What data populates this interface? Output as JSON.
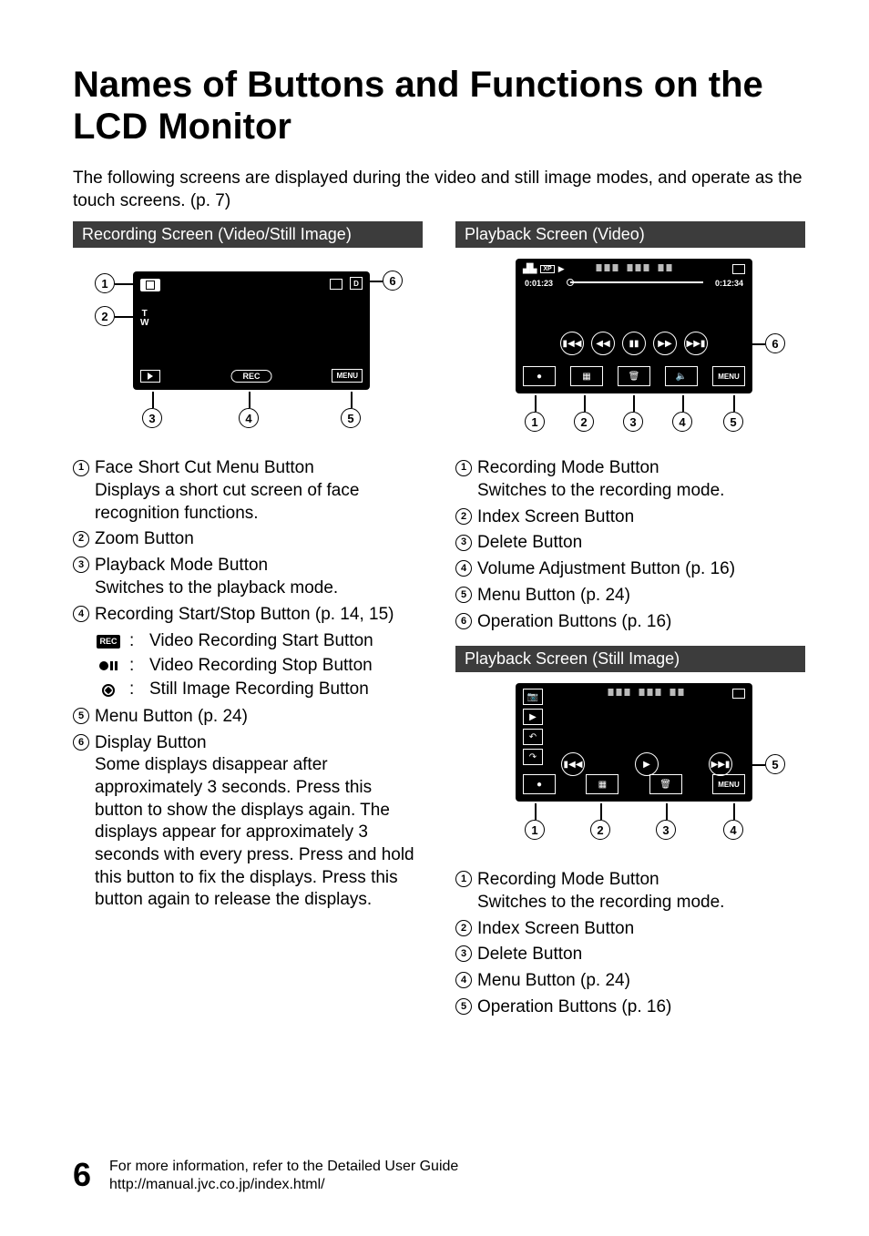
{
  "title": "Names of Buttons and Functions on the LCD Monitor",
  "intro": "The following screens are displayed during the video and still image modes, and operate as the touch screens. (p. 7)",
  "sections": {
    "rec": {
      "bar": "Recording Screen (Video/Still Image)"
    },
    "pv": {
      "bar": "Playback Screen (Video)"
    },
    "ps": {
      "bar": "Playback Screen (Still Image)"
    }
  },
  "rec_fig": {
    "zoom_top": "T",
    "zoom_bottom": "W",
    "rec_label": "REC",
    "menu_label": "MENU",
    "d_label": "D"
  },
  "pv_fig": {
    "elapsed": "0:01:23",
    "total": "0:12:34",
    "menu_label": "MENU"
  },
  "ps_fig": {
    "menu_label": "MENU"
  },
  "rec_list": [
    {
      "n": "1",
      "title": "Face Short Cut Menu Button",
      "desc": "Displays a short cut screen of face recognition functions."
    },
    {
      "n": "2",
      "title": "Zoom Button"
    },
    {
      "n": "3",
      "title": "Playback Mode Button",
      "desc": "Switches to the playback mode."
    },
    {
      "n": "4",
      "title": "Recording Start/Stop Button (p. 14, 15)",
      "icons": [
        {
          "type": "rec",
          "label": "Video Recording Start Button"
        },
        {
          "type": "stop",
          "label": "Video Recording Stop Button"
        },
        {
          "type": "still",
          "label": "Still Image Recording Button"
        }
      ]
    },
    {
      "n": "5",
      "title": "Menu Button (p. 24)"
    },
    {
      "n": "6",
      "title": "Display Button",
      "desc": "Some displays disappear after approximately 3 seconds. Press this button to show the displays again. The displays appear for approximately 3 seconds with every press. Press and hold this button to fix the displays. Press this button again to release the displays."
    }
  ],
  "pv_list": [
    {
      "n": "1",
      "title": "Recording Mode Button",
      "desc": "Switches to the recording mode."
    },
    {
      "n": "2",
      "title": "Index Screen Button"
    },
    {
      "n": "3",
      "title": "Delete Button"
    },
    {
      "n": "4",
      "title": "Volume Adjustment Button (p. 16)"
    },
    {
      "n": "5",
      "title": "Menu Button (p. 24)"
    },
    {
      "n": "6",
      "title": "Operation Buttons (p. 16)"
    }
  ],
  "ps_list": [
    {
      "n": "1",
      "title": "Recording Mode Button",
      "desc": "Switches to the recording mode."
    },
    {
      "n": "2",
      "title": "Index Screen Button"
    },
    {
      "n": "3",
      "title": "Delete Button"
    },
    {
      "n": "4",
      "title": "Menu Button (p. 24)"
    },
    {
      "n": "5",
      "title": "Operation Buttons (p. 16)"
    }
  ],
  "footer": {
    "page": "6",
    "line1": "For more information, refer to the Detailed User Guide",
    "line2": "http://manual.jvc.co.jp/index.html/"
  }
}
